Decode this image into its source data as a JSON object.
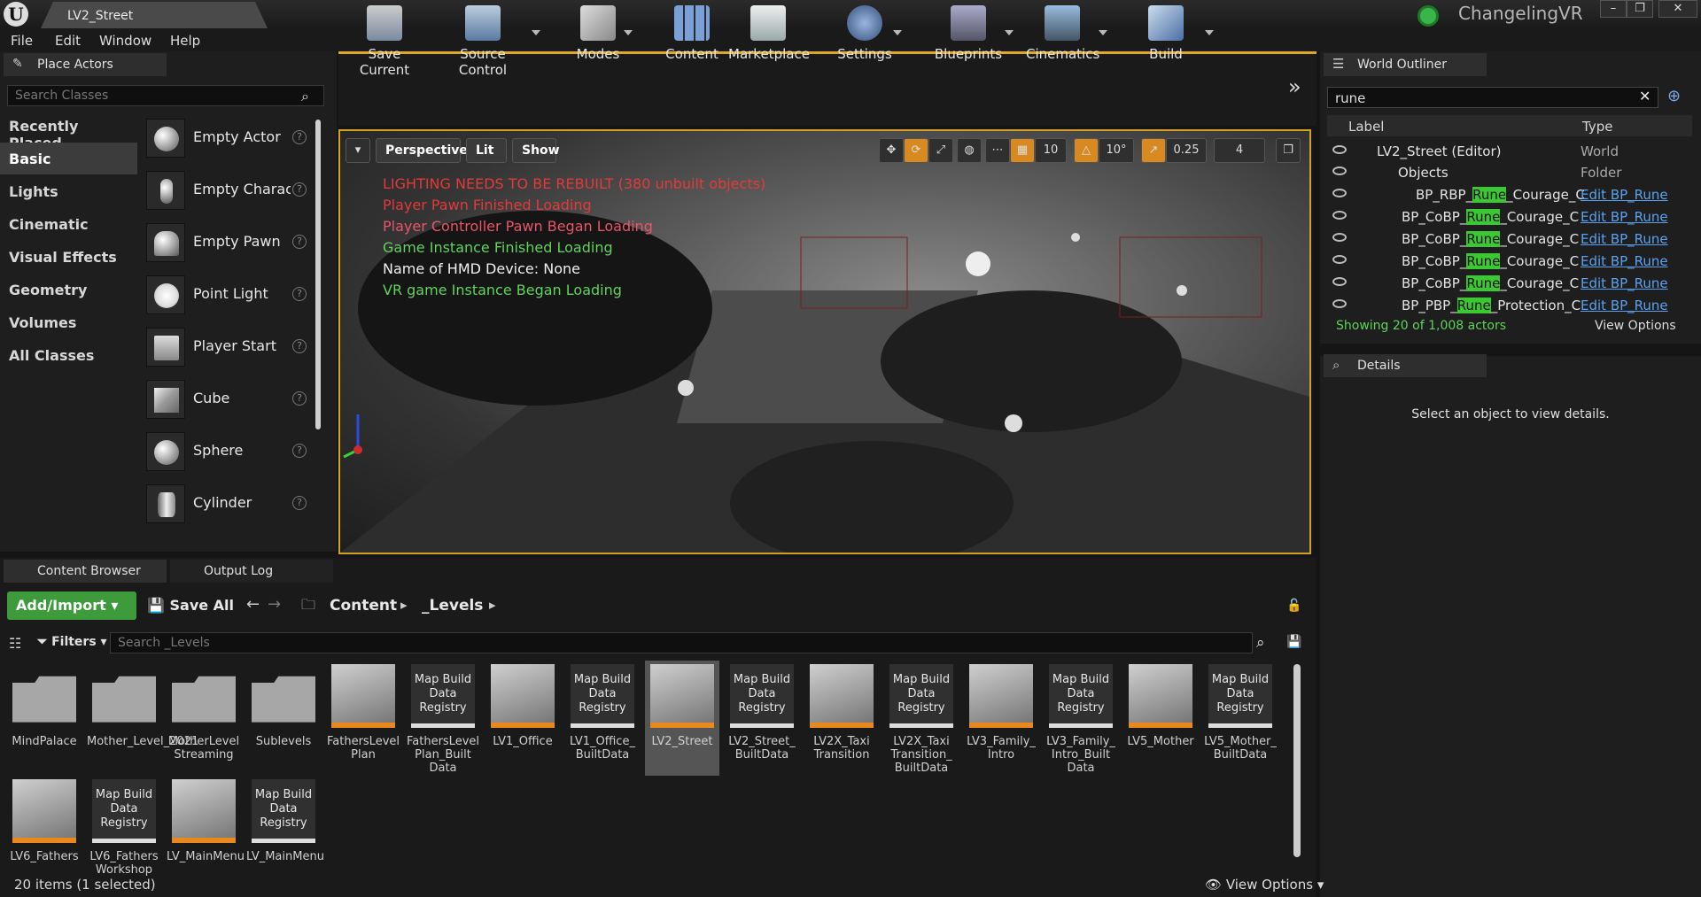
{
  "titlebar": {
    "doc_tab": "LV2_Street",
    "project": "ChangelingVR",
    "logo": "U"
  },
  "menu": [
    "File",
    "Edit",
    "Window",
    "Help"
  ],
  "place_actors": {
    "tab": "Place Actors",
    "search_placeholder": "Search Classes",
    "categories": [
      "Recently Placed",
      "Basic",
      "Lights",
      "Cinematic",
      "Visual Effects",
      "Geometry",
      "Volumes",
      "All Classes"
    ],
    "active_category": "Basic",
    "items": [
      "Empty Actor",
      "Empty Character",
      "Empty Pawn",
      "Point Light",
      "Player Start",
      "Cube",
      "Sphere",
      "Cylinder"
    ]
  },
  "toolbar": {
    "buttons": [
      "Save Current",
      "Source Control",
      "Modes",
      "Content",
      "Marketplace",
      "Settings",
      "Blueprints",
      "Cinematics",
      "Build"
    ],
    "overflow": "»"
  },
  "viewport": {
    "perspective": "Perspective",
    "lit": "Lit",
    "show": "Show",
    "grid_value": "10",
    "rot_value": "10°",
    "scale_value": "0.25",
    "cam_speed": "4",
    "messages": [
      {
        "text": "LIGHTING NEEDS TO BE REBUILT (380 unbuilt objects)",
        "color": "#e23a3a"
      },
      {
        "text": "Player Pawn Finished Loading",
        "color": "#e23a3a"
      },
      {
        "text": "Player Controller Pawn Began Loading",
        "color": "#e8556a"
      },
      {
        "text": "Game Instance Finished Loading",
        "color": "#5fd35a"
      },
      {
        "text": "Name of HMD Device: None",
        "color": "#f0f0f0"
      },
      {
        "text": "VR game Instance Began Loading",
        "color": "#5fd35a"
      }
    ]
  },
  "outliner": {
    "tab": "World Outliner",
    "search_value": "rune",
    "col_label": "Label",
    "col_type": "Type",
    "rows": [
      {
        "label": "LV2_Street (Editor)",
        "type": "World",
        "link": false
      },
      {
        "label": "Objects",
        "type": "Folder",
        "link": false
      },
      {
        "label": "BP_RBP_Rune_Courage_C",
        "type": "Edit BP_Rune",
        "link": true
      },
      {
        "label": "BP_CoBP_Rune_Courage_C",
        "type": "Edit BP_Rune",
        "link": true
      },
      {
        "label": "BP_CoBP_Rune_Courage_C",
        "type": "Edit BP_Rune",
        "link": true
      },
      {
        "label": "BP_CoBP_Rune_Courage_C",
        "type": "Edit BP_Rune",
        "link": true
      },
      {
        "label": "BP_CoBP_Rune_Courage_C",
        "type": "Edit BP_Rune",
        "link": true
      },
      {
        "label": "BP_PBP_Rune_Protection_C",
        "type": "Edit BP_Rune",
        "link": true
      }
    ],
    "status": "Showing 20 of 1,008 actors",
    "view_options": "View Options"
  },
  "details": {
    "tab": "Details",
    "empty_text": "Select an object to view details."
  },
  "content_browser": {
    "tabs": [
      "Content Browser",
      "Output Log"
    ],
    "add_import": "Add/Import",
    "save_all": "Save All",
    "path": [
      "Content",
      "_Levels"
    ],
    "filters": "Filters",
    "search_placeholder": "Search _Levels",
    "assets": [
      {
        "name": "MindPalace",
        "kind": "folder"
      },
      {
        "name": "Mother_Level_2021",
        "kind": "folder"
      },
      {
        "name": "MotherLevel Streaming",
        "kind": "folder"
      },
      {
        "name": "Sublevels",
        "kind": "folder"
      },
      {
        "name": "FathersLevel Plan",
        "kind": "level"
      },
      {
        "name": "FathersLevel Plan_Built Data",
        "kind": "registry"
      },
      {
        "name": "LV1_Office",
        "kind": "level"
      },
      {
        "name": "LV1_Office_ BuiltData",
        "kind": "registry"
      },
      {
        "name": "LV2_Street",
        "kind": "level",
        "selected": true
      },
      {
        "name": "LV2_Street_ BuiltData",
        "kind": "registry"
      },
      {
        "name": "LV2X_Taxi Transition",
        "kind": "level"
      },
      {
        "name": "LV2X_Taxi Transition_ BuiltData",
        "kind": "registry"
      },
      {
        "name": "LV3_Family_ Intro",
        "kind": "level"
      },
      {
        "name": "LV3_Family_ Intro_Built Data",
        "kind": "registry"
      },
      {
        "name": "LV5_Mother",
        "kind": "level"
      },
      {
        "name": "LV5_Mother_ BuiltData",
        "kind": "registry"
      },
      {
        "name": "LV6_Fathers",
        "kind": "level"
      },
      {
        "name": "LV6_Fathers Workshop",
        "kind": "registry"
      },
      {
        "name": "LV_MainMenu",
        "kind": "level"
      },
      {
        "name": "LV_MainMenu",
        "kind": "registry"
      }
    ],
    "registry_label": "Map Build Data Registry",
    "status": "20 items (1 selected)",
    "view_options": "View Options"
  }
}
